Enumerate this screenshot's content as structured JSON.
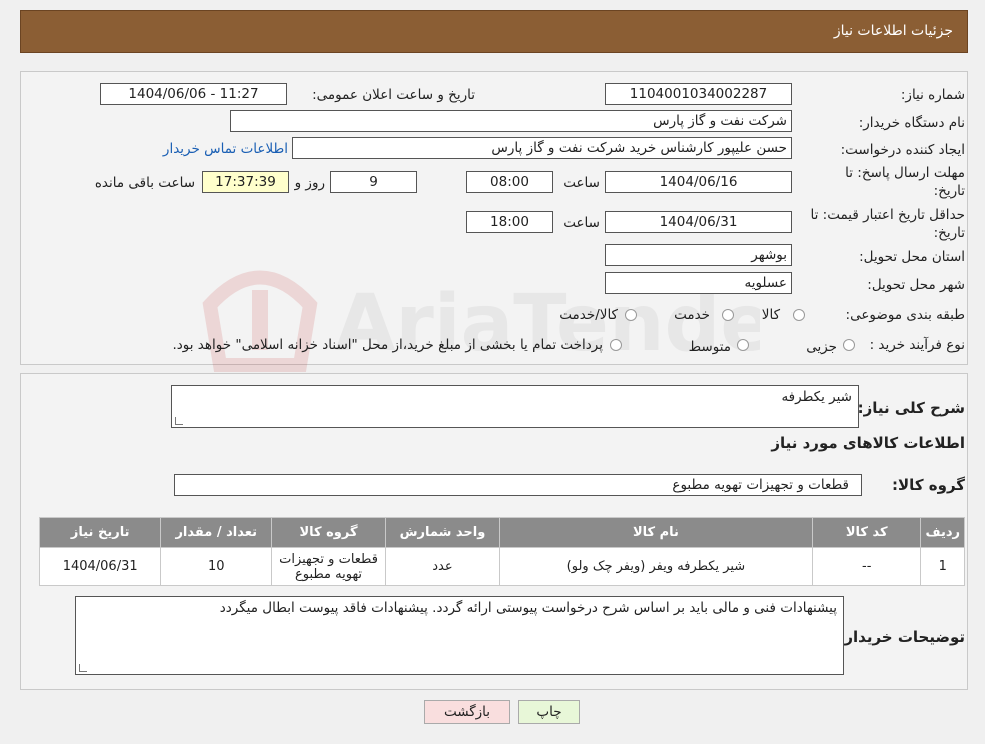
{
  "header": {
    "title": "جزئیات اطلاعات نیاز"
  },
  "fields": {
    "need_number_label": "شماره نیاز:",
    "need_number": "1104001034002287",
    "announce_label": "تاریخ و ساعت اعلان عمومی:",
    "announce_value": "1404/06/06 - 11:27",
    "buyer_org_label": "نام دستگاه خریدار:",
    "buyer_org": "شرکت نفت و گاز پارس",
    "creator_label": "ایجاد کننده درخواست:",
    "creator": "حسن علیپور کارشناس خرید شرکت نفت و گاز پارس",
    "contact_link": "اطلاعات تماس خریدار",
    "deadline_label": "مهلت ارسال پاسخ: تا تاریخ:",
    "deadline_date": "1404/06/16",
    "time_label": "ساعت",
    "deadline_time": "08:00",
    "days_count": "9",
    "days_label": "روز و",
    "remaining_time": "17:37:39",
    "remaining_label": "ساعت باقی مانده",
    "validity_label": "حداقل تاریخ اعتبار قیمت: تا تاریخ:",
    "validity_date": "1404/06/31",
    "validity_time": "18:00",
    "province_label": "استان محل تحویل:",
    "province": "بوشهر",
    "city_label": "شهر محل تحویل:",
    "city": "عسلویه",
    "category_label": "طبقه بندی موضوعی:",
    "category_options": [
      "کالا",
      "خدمت",
      "کالا/خدمت"
    ],
    "process_label": "نوع فرآیند خرید :",
    "process_options": [
      "جزیی",
      "متوسط"
    ],
    "process_note": "پرداخت تمام یا بخشی از مبلغ خرید،از محل \"اسناد خزانه اسلامی\" خواهد بود."
  },
  "summary": {
    "description_label": "شرح کلی نیاز:",
    "description": "شیر یکطرفه",
    "items_title": "اطلاعات کالاهای مورد نیاز",
    "group_label": "گروه کالا:",
    "group_value": "قطعات و تجهیزات تهویه مطبوع"
  },
  "table": {
    "headers": [
      "ردیف",
      "کد کالا",
      "نام کالا",
      "واحد شمارش",
      "گروه کالا",
      "تعداد / مقدار",
      "تاریخ نیاز"
    ],
    "rows": [
      [
        "1",
        "--",
        "شیر یکطرفه ویفر (ویفر چک ولو)",
        "عدد",
        "قطعات و تجهیزات تهویه مطبوع",
        "10",
        "1404/06/31"
      ]
    ]
  },
  "buyer_notes": {
    "label": "توضیحات خریدار:",
    "text": "پیشنهادات فنی و مالی باید بر اساس شرح درخواست پیوستی ارائه گردد. پیشنهادات فاقد پیوست ابطال میگردد"
  },
  "buttons": {
    "print": "چاپ",
    "back": "بازگشت"
  },
  "watermark_text": "AriaTender.neT",
  "colors": {
    "header_bg": "#8b5e34",
    "table_header_bg": "#8b8b8b",
    "print_btn": "#e8f7d8",
    "back_btn": "#f9dede"
  }
}
